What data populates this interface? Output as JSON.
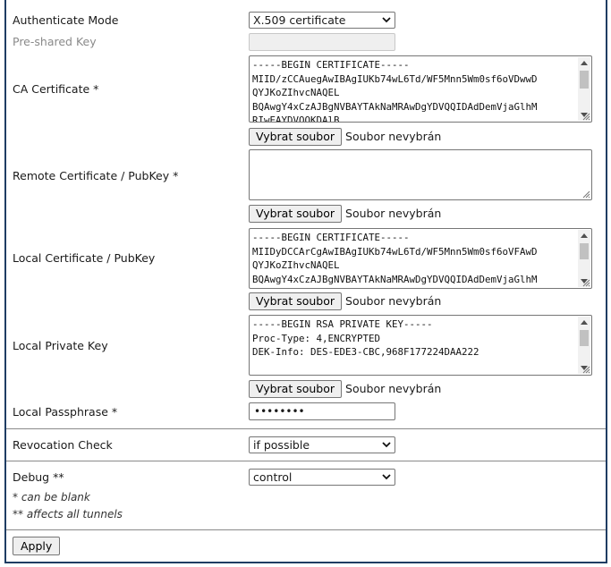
{
  "rows": {
    "auth_mode": {
      "label": "Authenticate Mode",
      "value": "X.509 certificate"
    },
    "psk": {
      "label": "Pre-shared Key",
      "value": ""
    },
    "ca_cert": {
      "label": "CA Certificate *",
      "content": "-----BEGIN CERTIFICATE-----\nMIID/zCCAuegAwIBAgIUKb74wL6Td/WF5Mnn5Wm0sf6oVDwwD\nQYJKoZIhvcNAQEL\nBQAwgY4xCzAJBgNVBAYTAkNaMRAwDgYDVQQIDAdDemVjaGlhM\nRIwEAYDVQQKDAlB",
      "browse_label": "Vybrat soubor",
      "file_status": "Soubor nevybrán"
    },
    "remote_cert": {
      "label": "Remote Certificate / PubKey *",
      "content": "",
      "browse_label": "Vybrat soubor",
      "file_status": "Soubor nevybrán"
    },
    "local_cert": {
      "label": "Local Certificate / PubKey",
      "content": "-----BEGIN CERTIFICATE-----\nMIIDyDCCArCgAwIBAgIUKb74wL6Td/WF5Mnn5Wm0sf6oVFAwD\nQYJKoZIhvcNAQEL\nBQAwgY4xCzAJBgNVBAYTAkNaMRAwDgYDVQQIDAdDemVjaGlhM\nRIwEAYDVQQKDAlB",
      "browse_label": "Vybrat soubor",
      "file_status": "Soubor nevybrán"
    },
    "local_key": {
      "label": "Local Private Key",
      "content": "-----BEGIN RSA PRIVATE KEY-----\nProc-Type: 4,ENCRYPTED\nDEK-Info: DES-EDE3-CBC,968F177224DAA222\n\n",
      "browse_label": "Vybrat soubor",
      "file_status": "Soubor nevybrán"
    },
    "passphrase": {
      "label": "Local Passphrase *",
      "value": "••••••••"
    },
    "revocation": {
      "label": "Revocation Check",
      "value": "if possible"
    },
    "debug": {
      "label": "Debug **",
      "value": "control"
    }
  },
  "notes": {
    "blank": "* can be blank",
    "tunnels": "** affects all tunnels"
  },
  "apply_label": "Apply"
}
